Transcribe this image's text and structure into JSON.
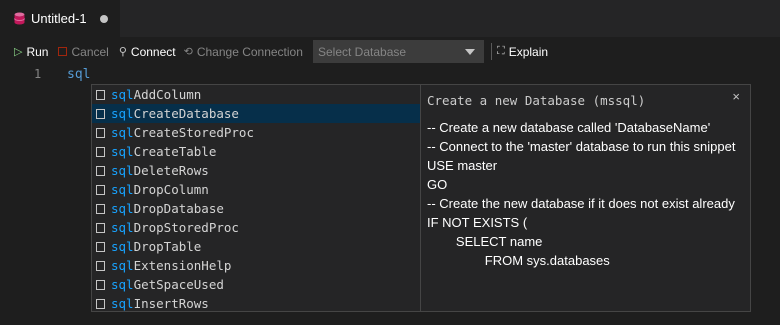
{
  "tab": {
    "title": "Untitled-1",
    "icon": "database-icon",
    "dirty": true
  },
  "toolbar": {
    "run": "Run",
    "cancel": "Cancel",
    "connect": "Connect",
    "change_connection": "Change Connection",
    "select_database_placeholder": "Select Database",
    "explain": "Explain"
  },
  "editor": {
    "line_number": "1",
    "code": "sql"
  },
  "suggest": {
    "prefix": "sql",
    "items": [
      "AddColumn",
      "CreateDatabase",
      "CreateStoredProc",
      "CreateTable",
      "DeleteRows",
      "DropColumn",
      "DropDatabase",
      "DropStoredProc",
      "DropTable",
      "ExtensionHelp",
      "GetSpaceUsed",
      "InsertRows"
    ],
    "selected_index": 1
  },
  "details": {
    "title": "Create a new Database (mssql)",
    "close": "×",
    "body": "-- Create a new database called 'DatabaseName'\n-- Connect to the 'master' database to run this snippet\nUSE master\nGO\n-- Create the new database if it does not exist already\nIF NOT EXISTS (\n        SELECT name\n                FROM sys.databases"
  }
}
